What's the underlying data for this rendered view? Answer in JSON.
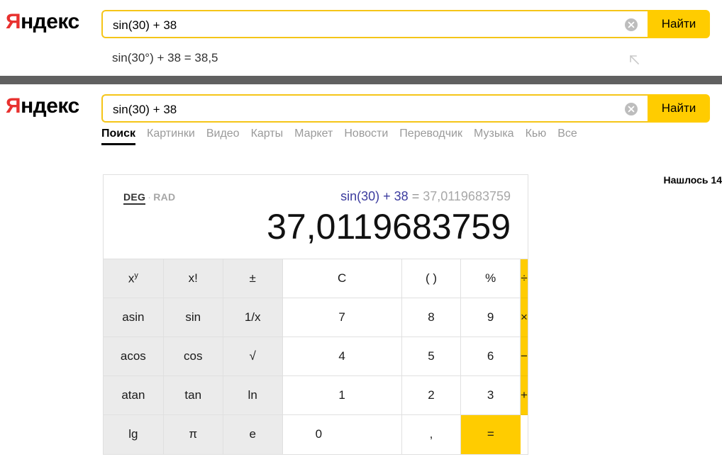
{
  "brand": {
    "logo_first": "Я",
    "logo_rest": "ндекс"
  },
  "top_screenshot": {
    "search": {
      "value": "sin(30) + 38",
      "placeholder": "Найти",
      "clear_icon": "close-circle-icon",
      "submit_label": "Найти"
    },
    "suggestion": {
      "text": "sin(30°) + 38 = 38,5",
      "insert_icon": "arrow-up-left-icon"
    }
  },
  "results_screenshot": {
    "search": {
      "value": "sin(30) + 38",
      "placeholder": "Найти",
      "clear_icon": "close-circle-icon",
      "submit_label": "Найти"
    },
    "tabs": [
      {
        "label": "Поиск",
        "active": true
      },
      {
        "label": "Картинки",
        "active": false
      },
      {
        "label": "Видео",
        "active": false
      },
      {
        "label": "Карты",
        "active": false
      },
      {
        "label": "Маркет",
        "active": false
      },
      {
        "label": "Новости",
        "active": false
      },
      {
        "label": "Переводчик",
        "active": false
      },
      {
        "label": "Музыка",
        "active": false
      },
      {
        "label": "Кью",
        "active": false
      },
      {
        "label": "Все",
        "active": false
      }
    ],
    "found_count": "Нашлось 14",
    "calculator": {
      "mode_deg": "DEG",
      "mode_separator": "·",
      "mode_rad": "RAD",
      "expression_formula": "sin(30) + 38",
      "expression_equals": " = ",
      "expression_result": "37,0119683759",
      "big_result": "37,0119683759",
      "keys": {
        "r1": [
          "x",
          "y",
          "x!",
          "±",
          "C",
          "( )",
          "%",
          "÷"
        ],
        "row1": {
          "k0_base": "x",
          "k0_sup": "y",
          "k1": "x!",
          "k2": "±",
          "k3": "C",
          "k4": "( )",
          "k5": "%",
          "k6": "÷"
        },
        "row2": {
          "k0": "asin",
          "k1": "sin",
          "k2": "1/x",
          "k3": "7",
          "k4": "8",
          "k5": "9",
          "k6": "×"
        },
        "row3": {
          "k0": "acos",
          "k1": "cos",
          "k2": "√",
          "k3": "4",
          "k4": "5",
          "k5": "6",
          "k6": "−"
        },
        "row4": {
          "k0": "atan",
          "k1": "tan",
          "k2": "ln",
          "k3": "1",
          "k4": "2",
          "k5": "3",
          "k6": "+"
        },
        "row5": {
          "k0": "lg",
          "k1": "π",
          "k2": "e",
          "k3": "0",
          "k4": ",",
          "k5": "="
        }
      }
    }
  },
  "colors": {
    "brand_red": "#e8312f",
    "brand_yellow": "#ffcc00",
    "strip_gray": "#606060",
    "key_gray": "#ebebeb",
    "formula_blue": "#3b3b9e"
  }
}
